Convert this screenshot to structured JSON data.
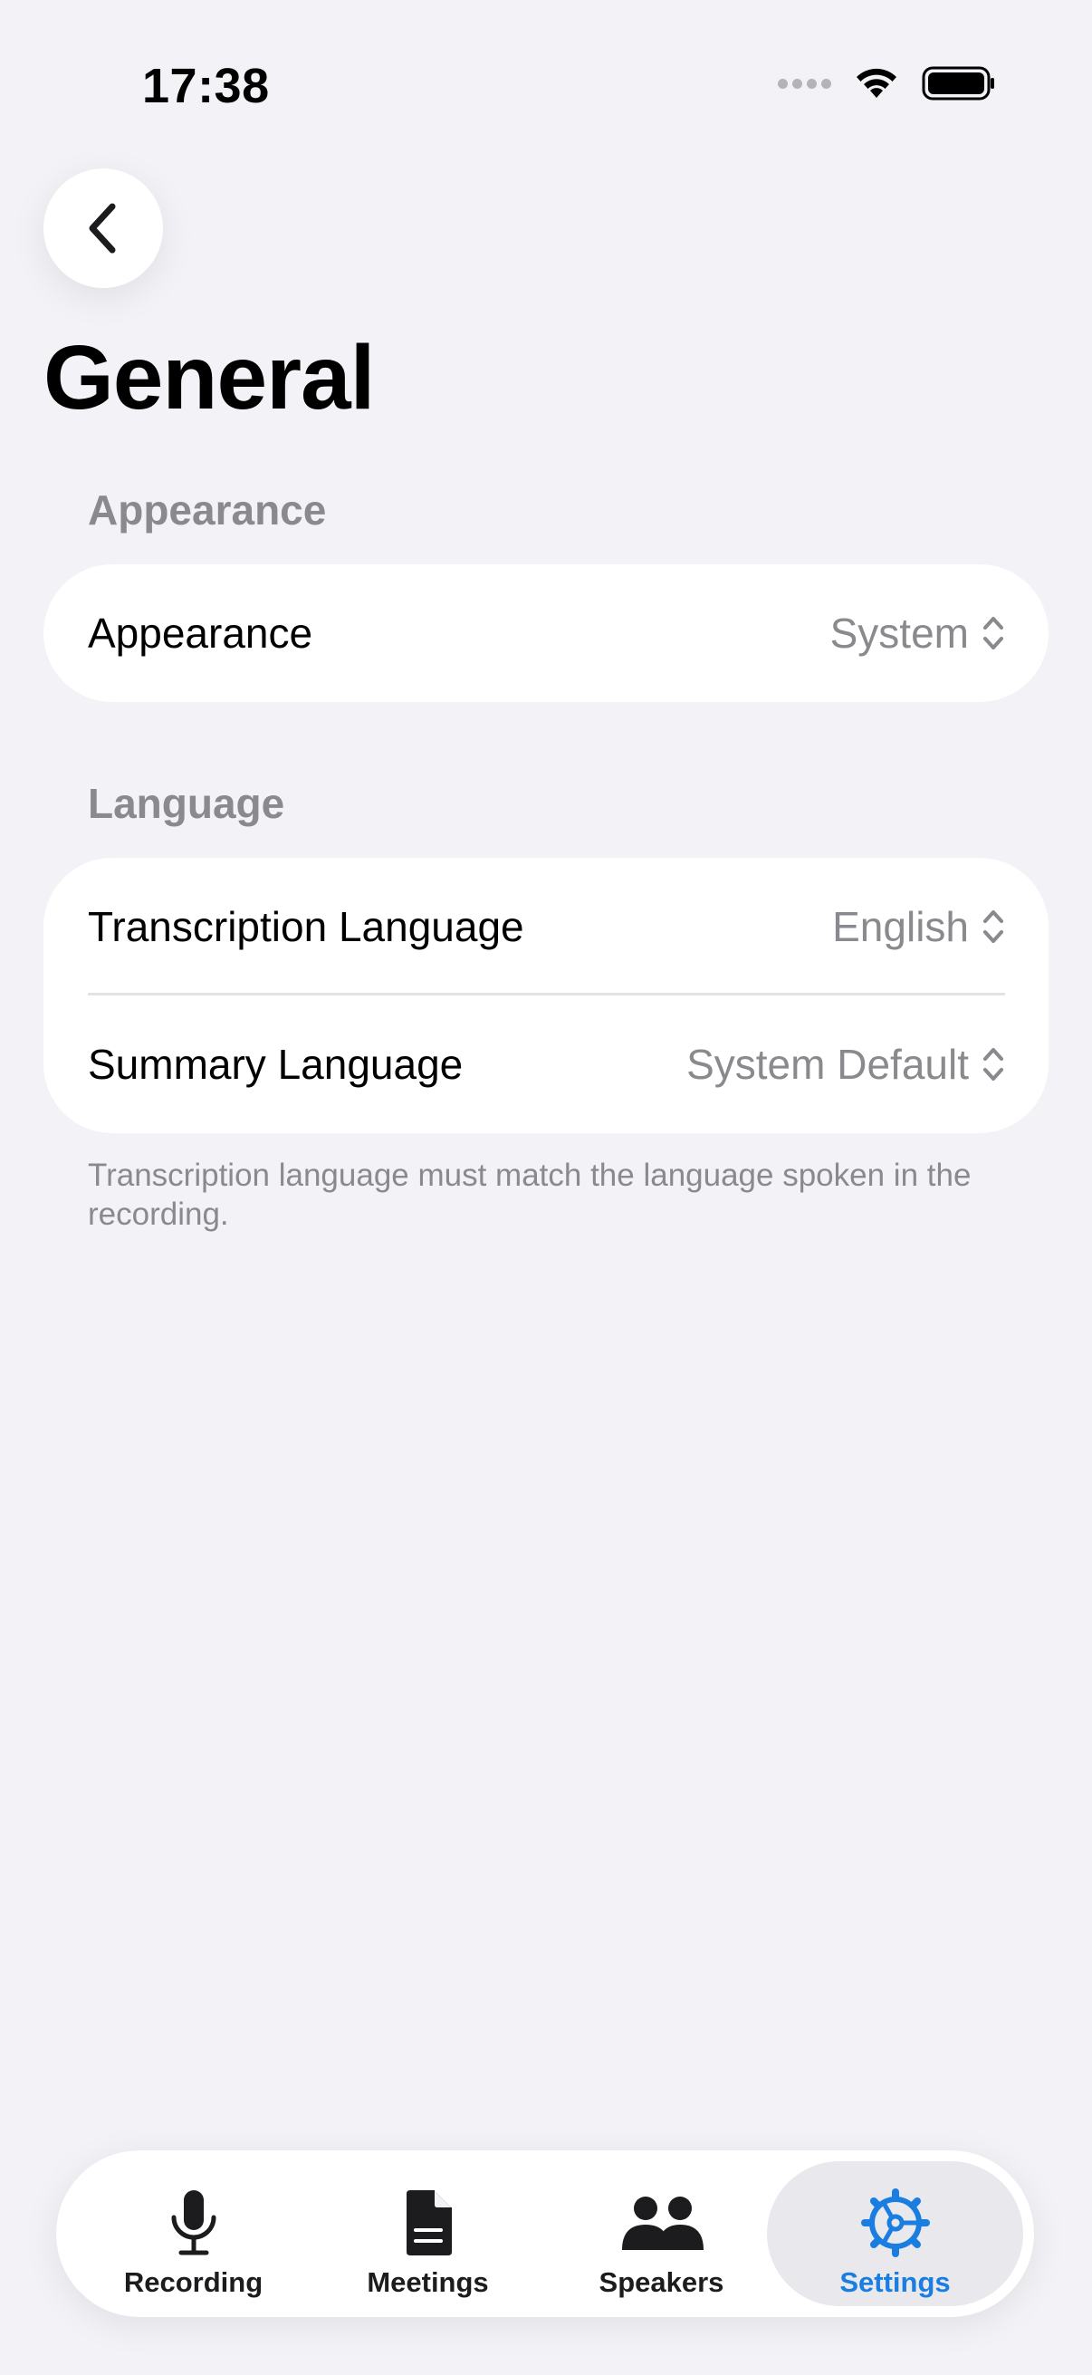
{
  "status_bar": {
    "time": "17:38"
  },
  "page": {
    "title": "General"
  },
  "sections": {
    "appearance": {
      "header": "Appearance",
      "rows": [
        {
          "label": "Appearance",
          "value": "System"
        }
      ]
    },
    "language": {
      "header": "Language",
      "rows": [
        {
          "label": "Transcription Language",
          "value": "English"
        },
        {
          "label": "Summary Language",
          "value": "System Default"
        }
      ],
      "footer": "Transcription language must match the language spoken in the recording."
    }
  },
  "tabbar": {
    "tabs": [
      {
        "label": "Recording",
        "icon": "microphone-icon"
      },
      {
        "label": "Meetings",
        "icon": "document-icon"
      },
      {
        "label": "Speakers",
        "icon": "people-icon"
      },
      {
        "label": "Settings",
        "icon": "gear-icon",
        "active": true
      }
    ]
  },
  "colors": {
    "accent": "#1a7de0",
    "background": "#f2f2f7",
    "secondary_text": "#8a8a8e"
  }
}
